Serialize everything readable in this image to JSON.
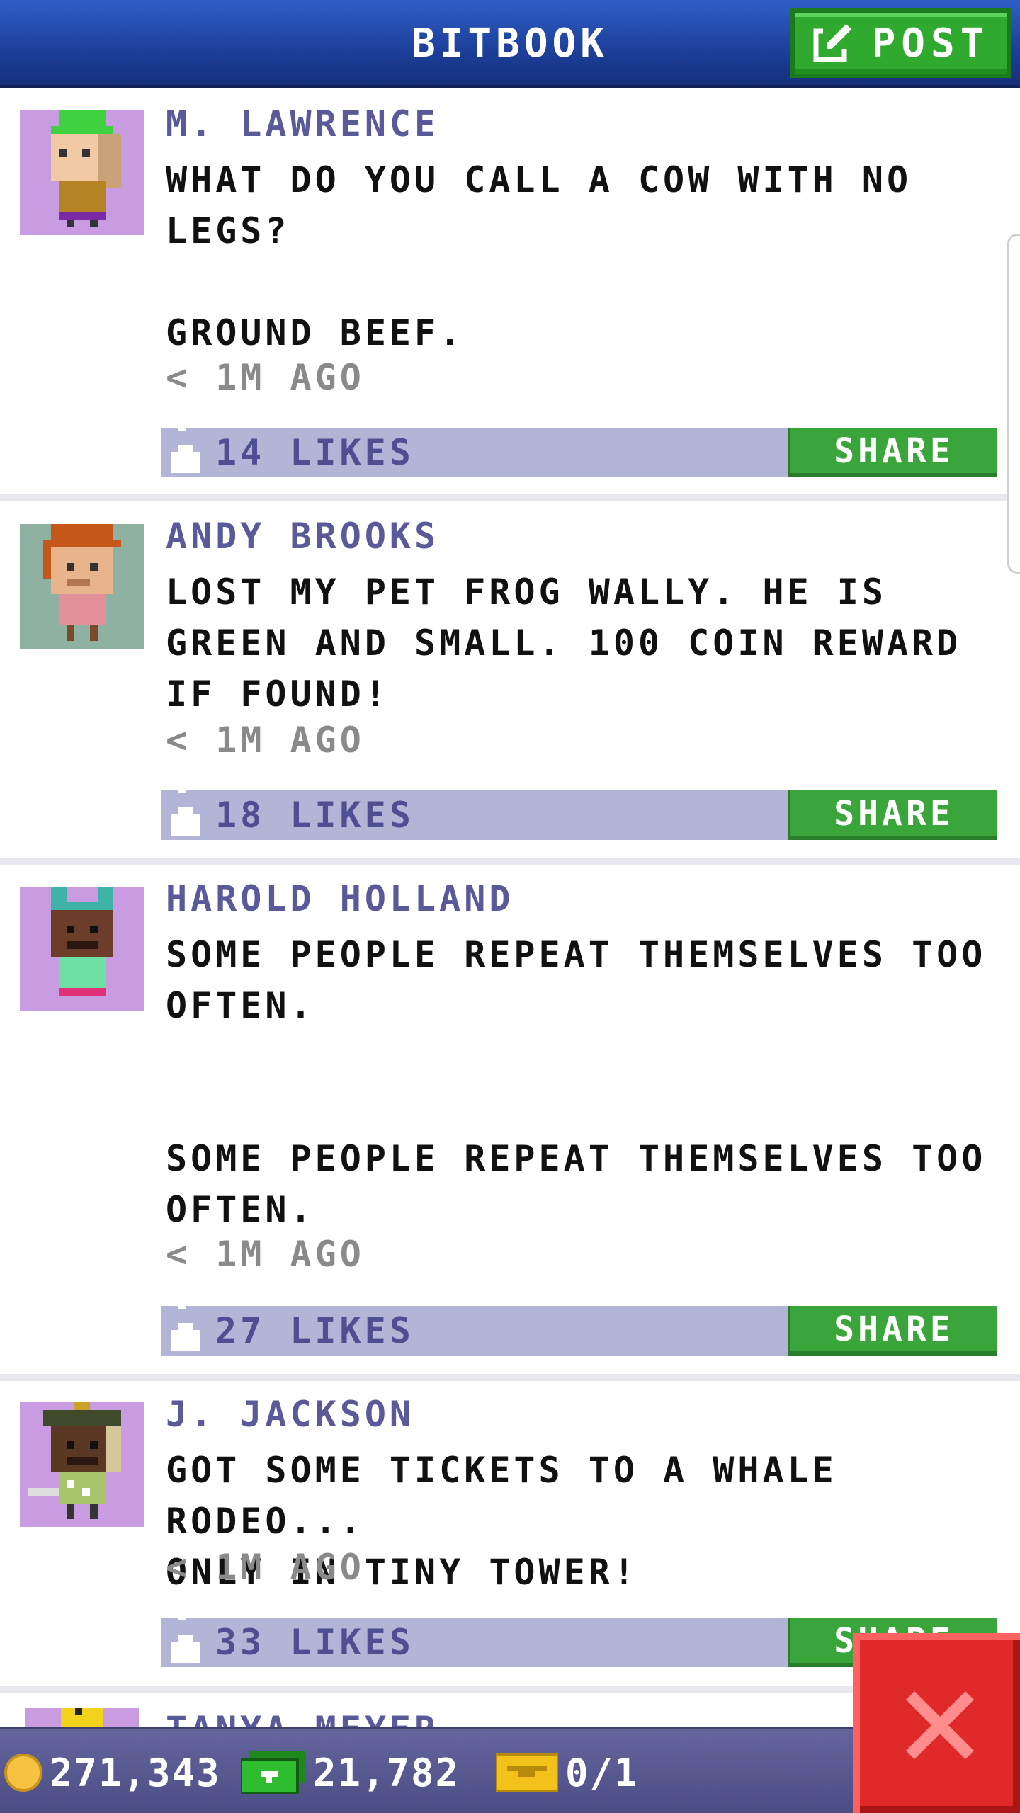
{
  "header": {
    "title": "BITBOOK",
    "post_label": "POST"
  },
  "posts": [
    {
      "author": "M. LAWRENCE",
      "text": "WHAT DO YOU CALL A COW WITH NO\nLEGS?\n\nGROUND BEEF.",
      "time": "< 1M AGO",
      "likes": "14 LIKES",
      "share_label": "SHARE",
      "avatar_bg": "#c99be0"
    },
    {
      "author": "ANDY BROOKS",
      "text": "LOST MY PET FROG WALLY. HE IS\nGREEN AND SMALL. 100 COIN REWARD\nIF FOUND!",
      "time": "< 1M AGO",
      "likes": "18 LIKES",
      "share_label": "SHARE",
      "avatar_bg": "#8fb1a1"
    },
    {
      "author": "HAROLD HOLLAND",
      "text": "SOME PEOPLE REPEAT THEMSELVES TOO\nOFTEN.\n\n\nSOME PEOPLE REPEAT THEMSELVES TOO\nOFTEN.",
      "time": "< 1M AGO",
      "likes": "27 LIKES",
      "share_label": "SHARE",
      "avatar_bg": "#c99be0"
    },
    {
      "author": "J. JACKSON",
      "text": "GOT SOME TICKETS TO A WHALE RODEO...\nONLY IN TINY TOWER!",
      "time": "< 1M AGO",
      "likes": "33 LIKES",
      "share_label": "SHARE",
      "avatar_bg": "#c99be0"
    }
  ],
  "partial_post": {
    "author": "TANYA MEYER"
  },
  "bottom_bar": {
    "coins": "271,343",
    "bux": "21,782",
    "tickets": "0/1"
  },
  "icons": {
    "post": "edit-icon",
    "like": "thumbs-up-icon",
    "coin": "coin-icon",
    "bux": "bux-icon",
    "ticket": "golden-ticket-icon",
    "close": "close-icon"
  },
  "colors": {
    "header": "#1c3f9a",
    "green_button": "#3aa53a",
    "likes_bar": "#b3b5d6",
    "author": "#5a5a9a",
    "close_button": "#e02a2a"
  }
}
